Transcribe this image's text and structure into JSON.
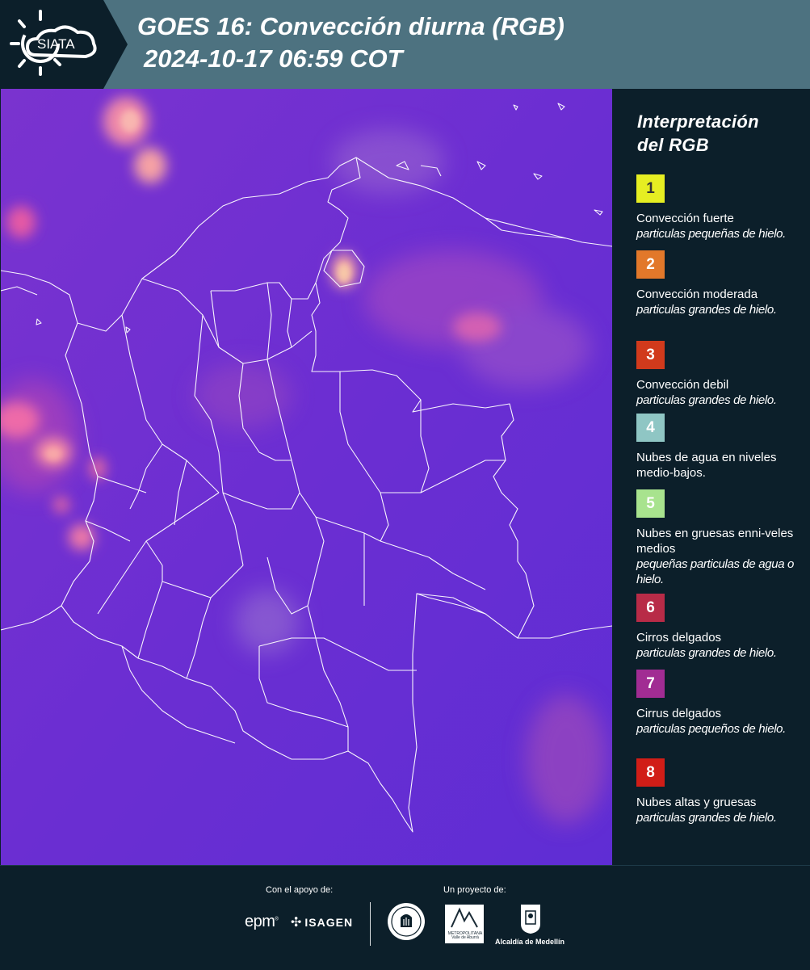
{
  "header": {
    "logo_text": "SIATA",
    "title_line1": "GOES 16: Convección diurna (RGB)",
    "title_line2": "2024-10-17 06:59 COT"
  },
  "legend": {
    "title_line1": "Interpretación",
    "title_line2": "del RGB",
    "items": [
      {
        "number": "1",
        "label": "Convección fuerte",
        "desc": "particulas pequeñas de hielo.",
        "color": "#e6ee22",
        "text_color": "#333333"
      },
      {
        "number": "2",
        "label": "Convección moderada",
        "desc": "particulas grandes de hielo.",
        "color": "#e2782a",
        "text_color": "#ffffff"
      },
      {
        "number": "3",
        "label": "Convección debil",
        "desc": "particulas grandes de hielo.",
        "color": "#d13a1c",
        "text_color": "#ffffff"
      },
      {
        "number": "4",
        "label": "Nubes de agua en niveles medio-bajos.",
        "desc": "",
        "color": "#8fc6c4",
        "text_color": "#ffffff"
      },
      {
        "number": "5",
        "label": "Nubes en gruesas enni-veles medios",
        "desc": "pequeñas particulas de agua o hielo.",
        "color": "#a8e38e",
        "text_color": "#ffffff"
      },
      {
        "number": "6",
        "label": "Cirros delgados",
        "desc": "particulas grandes de hielo.",
        "color": "#b82b47",
        "text_color": "#ffffff"
      },
      {
        "number": "7",
        "label": "Cirrus delgados",
        "desc": "particulas pequeños de hielo.",
        "color": "#a12c93",
        "text_color": "#ffffff"
      },
      {
        "number": "8",
        "label": "Nubes altas y gruesas",
        "desc": "particulas grandes de hielo.",
        "color": "#d11d17",
        "text_color": "#ffffff"
      }
    ]
  },
  "footer": {
    "support_label": "Con el apoyo de:",
    "project_label": "Un proyecto de:",
    "epm_text": "epm",
    "isagen_text": "ISAGEN",
    "area_text": "METROPOLITANA Valle de Aburrá",
    "alcaldia_text": "Alcaldía de Medellín"
  },
  "map": {
    "background_color": "#6a2fd0",
    "boundary_color": "#ffffff"
  }
}
